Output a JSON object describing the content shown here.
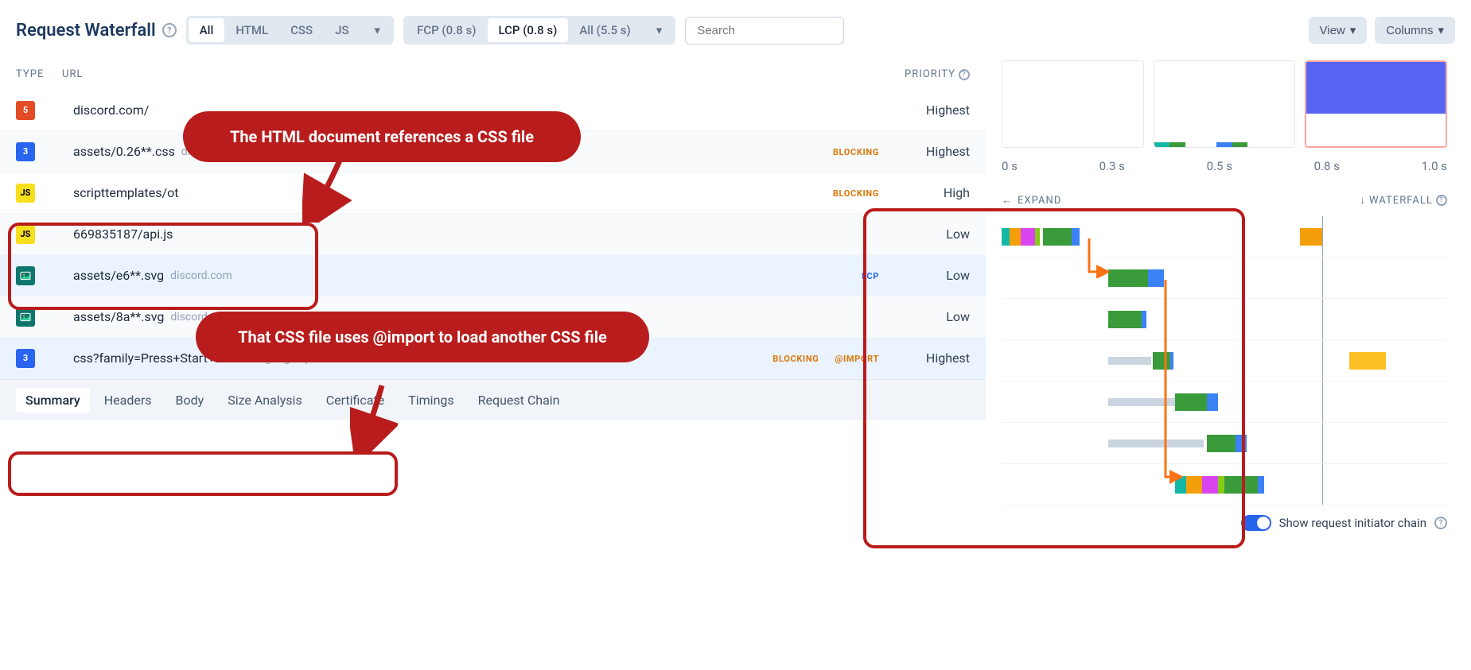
{
  "header": {
    "title": "Request Waterfall",
    "type_filters": [
      {
        "label": "All",
        "active": true
      },
      {
        "label": "HTML",
        "active": false
      },
      {
        "label": "CSS",
        "active": false
      },
      {
        "label": "JS",
        "active": false
      }
    ],
    "timing_filters": [
      {
        "label": "FCP (0.8 s)",
        "active": false
      },
      {
        "label": "LCP (0.8 s)",
        "active": true
      },
      {
        "label": "All (5.5 s)",
        "active": false
      }
    ],
    "search_placeholder": "Search",
    "view_btn": "View",
    "columns_btn": "Columns"
  },
  "timeline": {
    "ticks": [
      "0 s",
      "0.3 s",
      "0.5 s",
      "0.8 s",
      "1.0 s"
    ]
  },
  "columns": {
    "type": "TYPE",
    "url": "URL",
    "priority": "PRIORITY",
    "expand": "EXPAND",
    "waterfall": "WATERFALL"
  },
  "requests": [
    {
      "icon": "html",
      "url": "discord.com/",
      "domain": "",
      "badges": [],
      "priority": "Highest",
      "hl": false
    },
    {
      "icon": "css",
      "url": "assets/0.26**.css",
      "domain": "discord.com",
      "badges": [
        "BLOCKING"
      ],
      "priority": "Highest",
      "hl": false
    },
    {
      "icon": "js",
      "url": "scripttemplates/ot",
      "domain": "",
      "badges": [
        "BLOCKING"
      ],
      "priority": "High",
      "hl": false
    },
    {
      "icon": "js",
      "url": "669835187/api.js",
      "domain": "",
      "badges": [],
      "priority": "Low",
      "hl": false
    },
    {
      "icon": "img",
      "url": "assets/e6**.svg",
      "domain": "discord.com",
      "badges": [
        "LCP"
      ],
      "priority": "Low",
      "hl": true
    },
    {
      "icon": "img",
      "url": "assets/8a**.svg",
      "domain": "discord.com",
      "badges": [],
      "priority": "Low",
      "hl": false
    },
    {
      "icon": "css",
      "url": "css?family=Press+Start+2P",
      "domain": "fonts.googleapis.com",
      "badges": [
        "BLOCKING",
        "@IMPORT"
      ],
      "priority": "Highest",
      "hl": true
    }
  ],
  "annotations": {
    "first": "The HTML document references a CSS file",
    "second": "That CSS file uses @import to load another CSS file"
  },
  "bottom_tabs": [
    "Summary",
    "Headers",
    "Body",
    "Size Analysis",
    "Certificate",
    "Timings",
    "Request Chain"
  ],
  "toggle_label": "Show request initiator chain",
  "colors": {
    "green": "#3a9b3a",
    "teal": "#14b8a6",
    "orange": "#f59e0b",
    "blue": "#3b82f6",
    "magenta": "#d946ef",
    "lime": "#84cc16"
  }
}
